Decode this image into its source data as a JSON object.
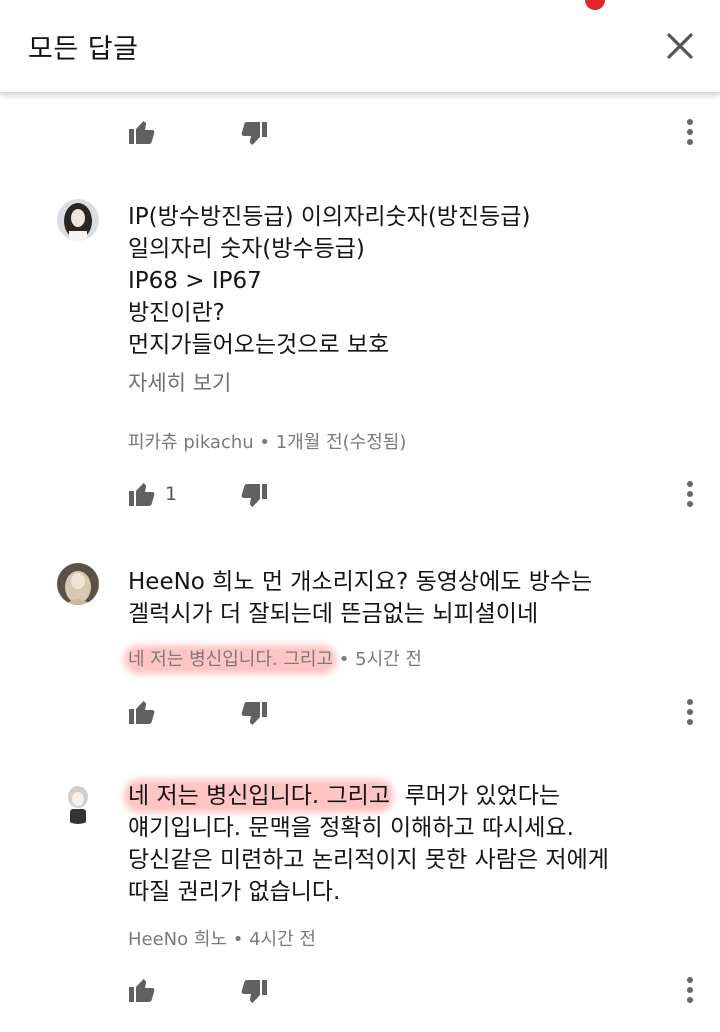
{
  "header": {
    "title": "모든 답글"
  },
  "comments": [
    {
      "lines": [
        "IP(방수방진등급)  이의자리숫자(방진등급)",
        "일의자리 숫자(방수등급)",
        "IP68 > IP67",
        "방진이란?",
        "먼지가들어오는것으로 보호"
      ],
      "read_more": "자세히 보기",
      "author": "피카츄 pikachu",
      "separator": "•",
      "time": "1개월 전(수정됨)",
      "likes": "1"
    },
    {
      "lines": [
        "HeeNo 희노 먼 개소리지요? 동영상에도 방수는",
        "겔럭시가 더 잘되는데 뜬금없는 뇌피셜이네"
      ],
      "author": "네 저는 병신입니다. 그리고",
      "separator": "•",
      "time": "5시간 전"
    },
    {
      "line1_highlight": "네 저는 병신입니다. 그리고",
      "line1_rest": "  루머가 있었다는",
      "lines": [
        "얘기입니다. 문맥을 정확히 이해하고 따시세요.",
        "당신같은 미련하고 논리적이지 못한 사람은 저에게",
        "따질 권리가 없습니다."
      ],
      "author": "HeeNo 희노",
      "separator": "•",
      "time": "4시간 전"
    }
  ],
  "icons": {
    "like": "thumbs-up-icon",
    "dislike": "thumbs-down-icon",
    "more": "more-vert-icon",
    "close": "close-icon"
  },
  "colors": {
    "highlight": "#ff9696",
    "notification": "#e3262b"
  }
}
